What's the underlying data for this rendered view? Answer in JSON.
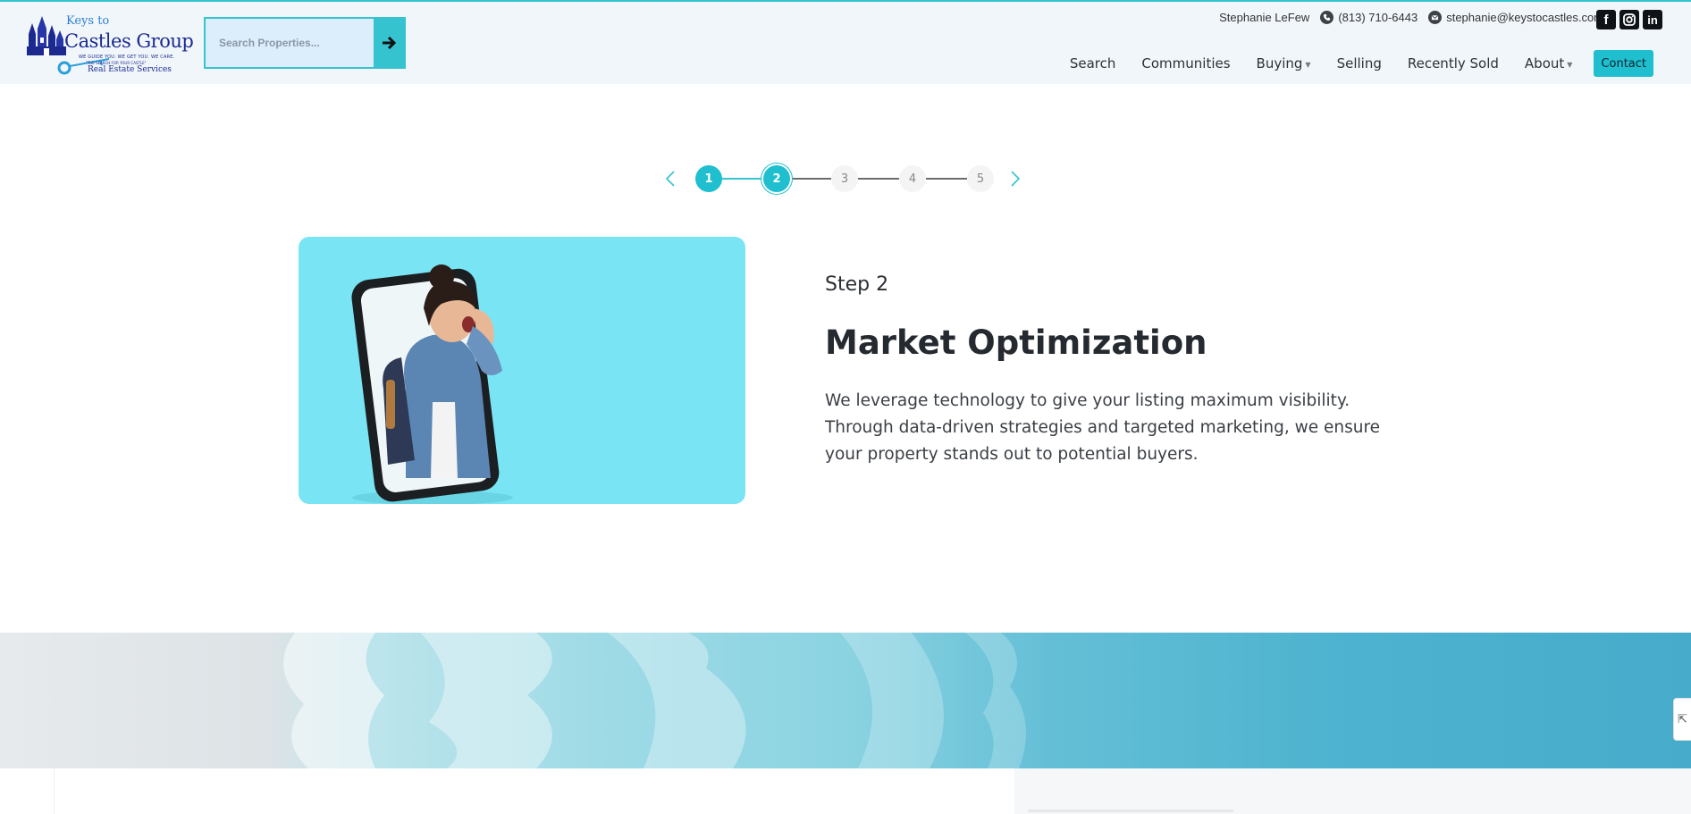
{
  "brand": {
    "logo_top": "Keys to",
    "logo_name": "Castles Group",
    "logo_tagline": "WE GUIDE YOU. WE GET YOU. WE CARE.",
    "logo_tagline2": "\"THE SEARCH FOR YOUR CASTLE\"",
    "logo_sub": "Real Estate Services"
  },
  "search": {
    "placeholder": "Search Properties...",
    "button_icon": "arrow-right-icon"
  },
  "contact": {
    "agent_name": "Stephanie LeFew",
    "phone": "(813) 710-6443",
    "email": "stephanie@keystocastles.com"
  },
  "social": [
    {
      "name": "facebook",
      "label": "f"
    },
    {
      "name": "instagram",
      "label": ""
    },
    {
      "name": "linkedin",
      "label": "in"
    }
  ],
  "nav": {
    "items": [
      {
        "label": "Search",
        "dropdown": false
      },
      {
        "label": "Communities",
        "dropdown": false
      },
      {
        "label": "Buying",
        "dropdown": true
      },
      {
        "label": "Selling",
        "dropdown": false
      },
      {
        "label": "Recently Sold",
        "dropdown": false
      },
      {
        "label": "About",
        "dropdown": true
      }
    ],
    "cta": "Contact"
  },
  "stepper": {
    "steps": [
      "1",
      "2",
      "3",
      "4",
      "5"
    ],
    "current": 2
  },
  "step": {
    "label": "Step 2",
    "title": "Market Optimization",
    "description": "We leverage technology to give your listing maximum visibility. Through data-driven strategies and targeted marketing, we ensure your property stands out to potential buyers."
  },
  "colors": {
    "accent": "#1fbfd0",
    "card_bg": "#79e4f3",
    "header_bg": "#f1f6fb",
    "text": "#2a2f36"
  }
}
